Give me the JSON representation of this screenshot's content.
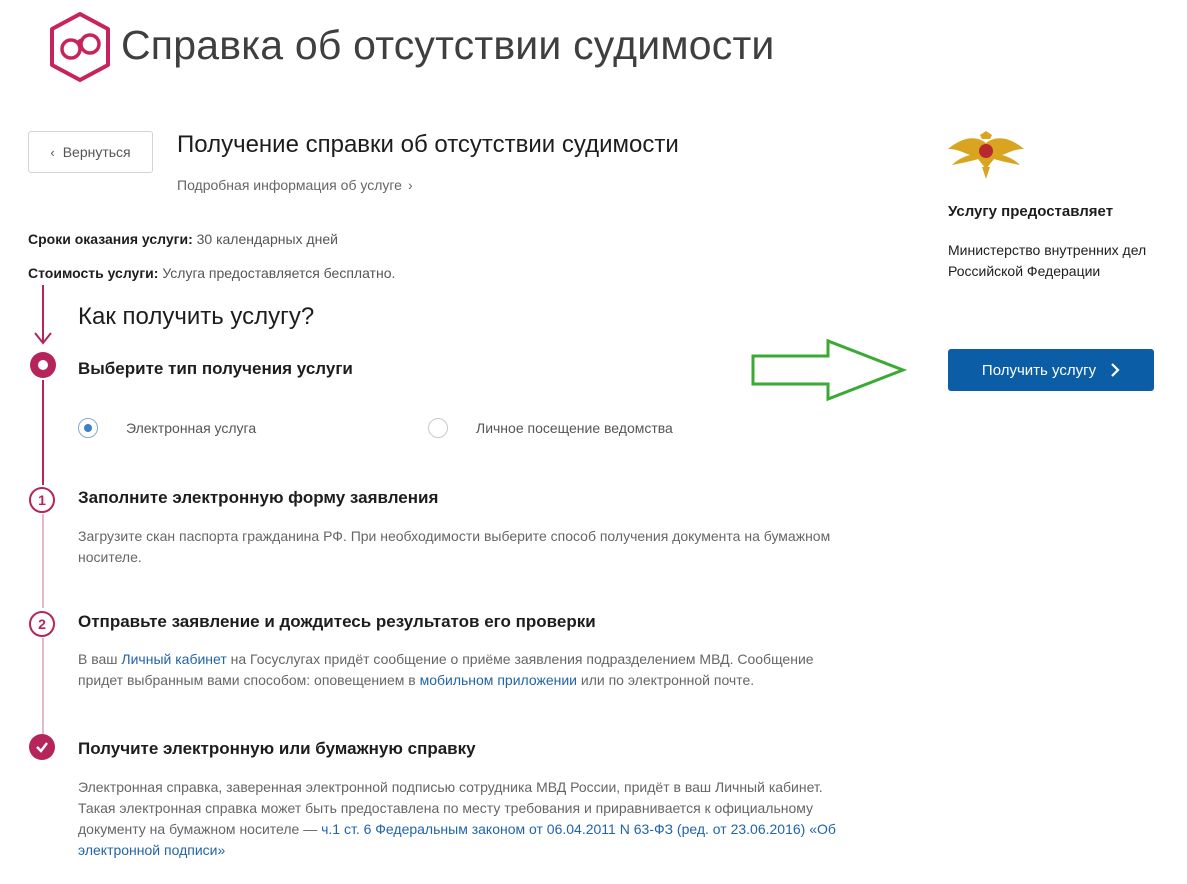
{
  "header": {
    "title": "Справка об отсутствии судимости"
  },
  "nav": {
    "back_label": "Вернуться"
  },
  "service": {
    "title": "Получение справки об отсутствии судимости",
    "details_link": "Подробная информация об услуге",
    "term_label": "Сроки оказания услуги:",
    "term_value": "30 календарных дней",
    "cost_label": "Стоимость услуги:",
    "cost_value": "Услуга предоставляется бесплатно."
  },
  "how": {
    "title": "Как получить услугу?",
    "step0_title": "Выберите тип получения услуги",
    "options": [
      {
        "label": "Электронная услуга",
        "selected": true
      },
      {
        "label": "Личное посещение ведомства",
        "selected": false
      }
    ],
    "steps": [
      {
        "number": "1",
        "title": "Заполните электронную форму заявления",
        "desc": "Загрузите скан паспорта гражданина РФ. При необходимости выберите способ получения документа на бумажном носителе."
      },
      {
        "number": "2",
        "title": "Отправьте заявление и дождитесь результатов его проверки",
        "desc_a": "В ваш ",
        "link_a": "Личный кабинет",
        "desc_b": " на Госуслугах придёт сообщение о приёме заявления подразделением МВД. Сообщение придет выбранным вами способом: оповещением в ",
        "link_b": "мобильном приложении",
        "desc_c": " или по электронной почте."
      },
      {
        "title": "Получите электронную или бумажную справку",
        "desc_a": "Электронная справка, заверенная электронной подписью сотрудника МВД России, придёт в ваш Личный кабинет. Такая электронная справка может быть предоставлена по месту требования и приравнивается к официальному документу на бумажном носителе — ",
        "link_a": "ч.1 ст. 6 Федеральным законом от 06.04.2011 N 63-ФЗ (ред. от 23.06.2016) «Об электронной подписи»"
      }
    ]
  },
  "provider": {
    "label": "Услугу предоставляет",
    "name_line1": "Министерство внутренних дел",
    "name_line2": "Российской Федерации"
  },
  "cta": {
    "label": "Получить услугу"
  },
  "colors": {
    "accent": "#b5245a",
    "primary_button": "#0b5ea6",
    "link": "#2264a8",
    "annotation_arrow": "#3aaa35"
  }
}
